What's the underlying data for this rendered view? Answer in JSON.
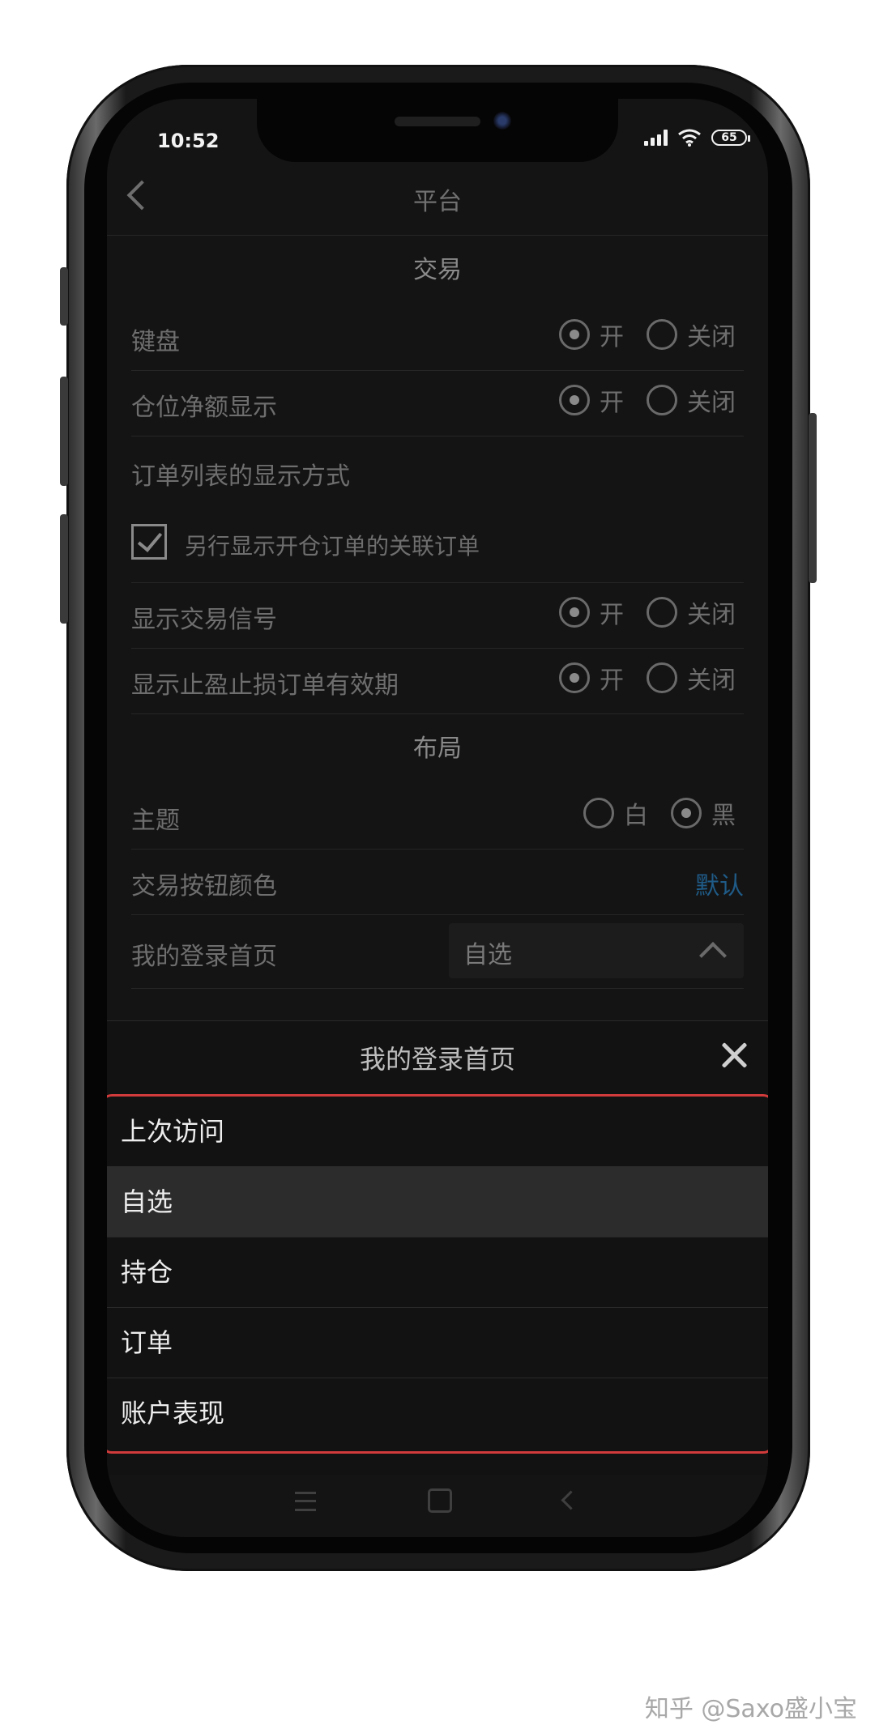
{
  "status_bar": {
    "time": "10:52",
    "battery": "65"
  },
  "header": {
    "title": "平台"
  },
  "trading": {
    "section_title": "交易",
    "keyboard": {
      "label": "键盘",
      "on": "开",
      "off": "关闭",
      "selected": "on"
    },
    "net_position": {
      "label": "仓位净额显示",
      "on": "开",
      "off": "关闭",
      "selected": "on"
    },
    "order_list_label": "订单列表的显示方式",
    "checkbox_label": "另行显示开仓订单的关联订单",
    "signals": {
      "label": "显示交易信号",
      "on": "开",
      "off": "关闭",
      "selected": "on"
    },
    "tp_sl_expiry": {
      "label": "显示止盈止损订单有效期",
      "on": "开",
      "off": "关闭",
      "selected": "on"
    }
  },
  "layout": {
    "section_title": "布局",
    "theme": {
      "label": "主题",
      "white": "白",
      "black": "黑",
      "selected": "black"
    },
    "button_color": {
      "label": "交易按钮颜色",
      "value": "默认"
    },
    "login_home": {
      "label": "我的登录首页",
      "value": "自选"
    }
  },
  "sheet": {
    "title": "我的登录首页",
    "options": [
      "上次访问",
      "自选",
      "持仓",
      "订单",
      "账户表现"
    ],
    "selected_index": 1
  },
  "watermark": "知乎 @Saxo盛小宝",
  "colors": {
    "highlight_border": "#d23b3b",
    "link": "#1f5b87"
  }
}
